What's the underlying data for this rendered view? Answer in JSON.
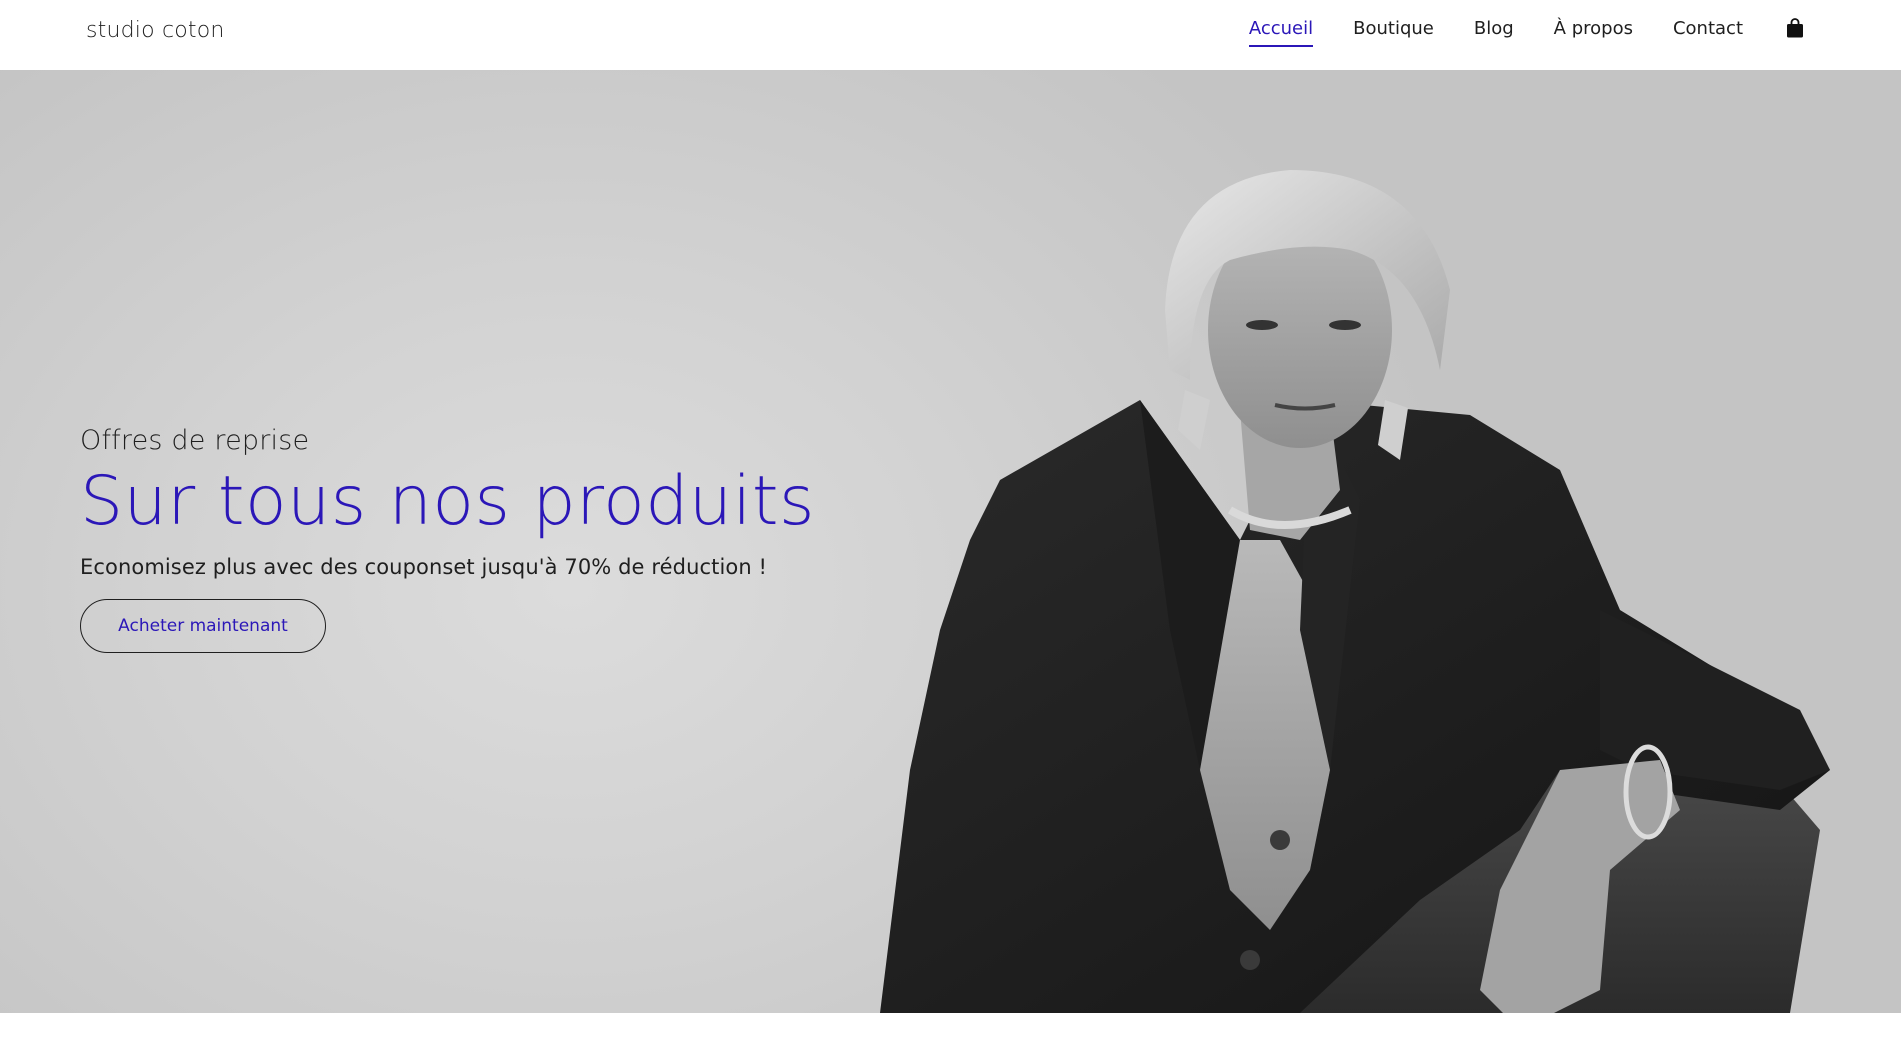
{
  "header": {
    "logo": "studio coton",
    "nav": [
      {
        "label": "Accueil",
        "active": true
      },
      {
        "label": "Boutique",
        "active": false
      },
      {
        "label": "Blog",
        "active": false
      },
      {
        "label": "À propos",
        "active": false
      },
      {
        "label": "Contact",
        "active": false
      }
    ],
    "cart_icon": "shopping-bag-icon"
  },
  "hero": {
    "kicker": "Offres de reprise",
    "title": "Sur tous nos produits",
    "subtitle": "Economisez plus avec des couponset jusqu'à 70% de réduction !",
    "cta_label": "Acheter maintenant",
    "image": "black-and-white-model-portrait"
  },
  "colors": {
    "accent": "#2b17b8",
    "text": "#1f1f1f",
    "background": "#ffffff",
    "hero_bg": "#d2d2d2"
  }
}
